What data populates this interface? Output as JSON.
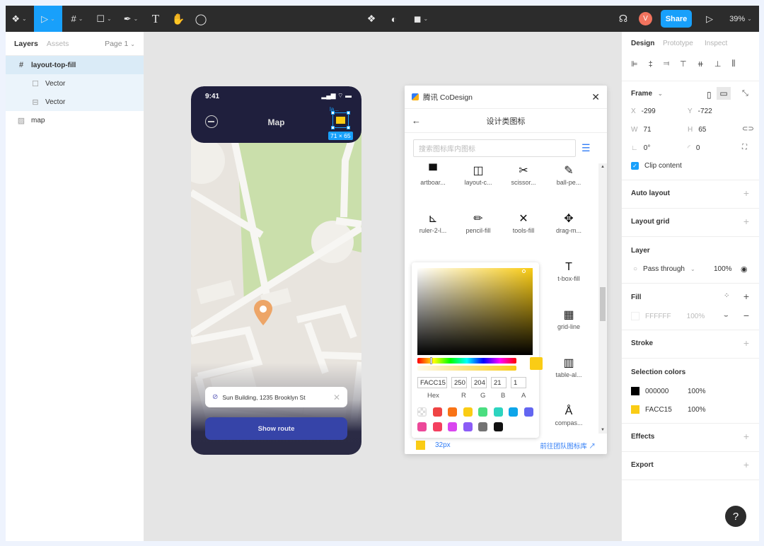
{
  "toolbar": {
    "tools": [
      "main-menu",
      "move",
      "frame",
      "shape",
      "pen",
      "text",
      "hand",
      "comment"
    ],
    "share_label": "Share",
    "avatar_initial": "V",
    "zoom": "39%"
  },
  "layers_panel": {
    "tab_layers": "Layers",
    "tab_assets": "Assets",
    "page": "Page 1",
    "items": [
      {
        "name": "layout-top-fill",
        "icon": "frame-icon",
        "selected": true
      },
      {
        "name": "Vector",
        "icon": "vector-icon"
      },
      {
        "name": "Vector",
        "icon": "vector-icon"
      },
      {
        "name": "map",
        "icon": "image-icon"
      }
    ]
  },
  "phone": {
    "time": "9:41",
    "title": "Map",
    "selection_label": "la...",
    "selection_size": "71 × 65",
    "address": "Sun Building, 1235 Brooklyn St",
    "button": "Show route"
  },
  "plugin": {
    "brand": "腾讯 CoDesign",
    "title": "设计类图标",
    "search_placeholder": "搜索图标库内图标",
    "icons": [
      {
        "label": "artboar...",
        "glyph": "▀"
      },
      {
        "label": "layout-c...",
        "glyph": "◫"
      },
      {
        "label": "scissor...",
        "glyph": "✂"
      },
      {
        "label": "ball-pe...",
        "glyph": "✎"
      },
      {
        "label": "ruler-2-l...",
        "glyph": "⊾"
      },
      {
        "label": "pencil-fill",
        "glyph": "✏"
      },
      {
        "label": "tools-fill",
        "glyph": "✕"
      },
      {
        "label": "drag-m...",
        "glyph": "✥"
      },
      {
        "label": "t-box-fill",
        "glyph": "T"
      },
      {
        "label": "grid-line",
        "glyph": "▦"
      },
      {
        "label": "table-al...",
        "glyph": "▥"
      },
      {
        "label": "compas...",
        "glyph": "Å"
      }
    ],
    "picker": {
      "hex": "FACC15",
      "r": "250",
      "g": "204",
      "b": "21",
      "a": "1",
      "labels": {
        "hex": "Hex",
        "r": "R",
        "g": "G",
        "b": "B",
        "a": "A"
      },
      "swatches": [
        "transparent",
        "#ef4444",
        "#f97316",
        "#facc15",
        "#4ade80",
        "#2dd4bf",
        "#0ea5e9",
        "#6366f1",
        "#ec4899",
        "#f43f5e",
        "#d946ef",
        "#8b5cf6",
        "#737373",
        "#111111"
      ]
    },
    "size": "32px",
    "team_link": "前往团队图标库"
  },
  "design_panel": {
    "tabs": [
      "Design",
      "Prototype",
      "Inspect"
    ],
    "frame_label": "Frame",
    "x": "-299",
    "y": "-722",
    "w": "71",
    "h": "65",
    "rotation": "0°",
    "radius": "0",
    "clip_content": "Clip content",
    "auto_layout": "Auto layout",
    "layout_grid": "Layout grid",
    "layer": "Layer",
    "blend": "Pass through",
    "layer_opacity": "100%",
    "fill": "Fill",
    "fill_hex": "FFFFFF",
    "fill_opacity": "100%",
    "stroke": "Stroke",
    "selection_colors": "Selection colors",
    "colors": [
      {
        "hex": "000000",
        "opacity": "100%",
        "color": "#000000"
      },
      {
        "hex": "FACC15",
        "opacity": "100%",
        "color": "#facc15"
      }
    ],
    "effects": "Effects",
    "export": "Export"
  },
  "help": "?"
}
